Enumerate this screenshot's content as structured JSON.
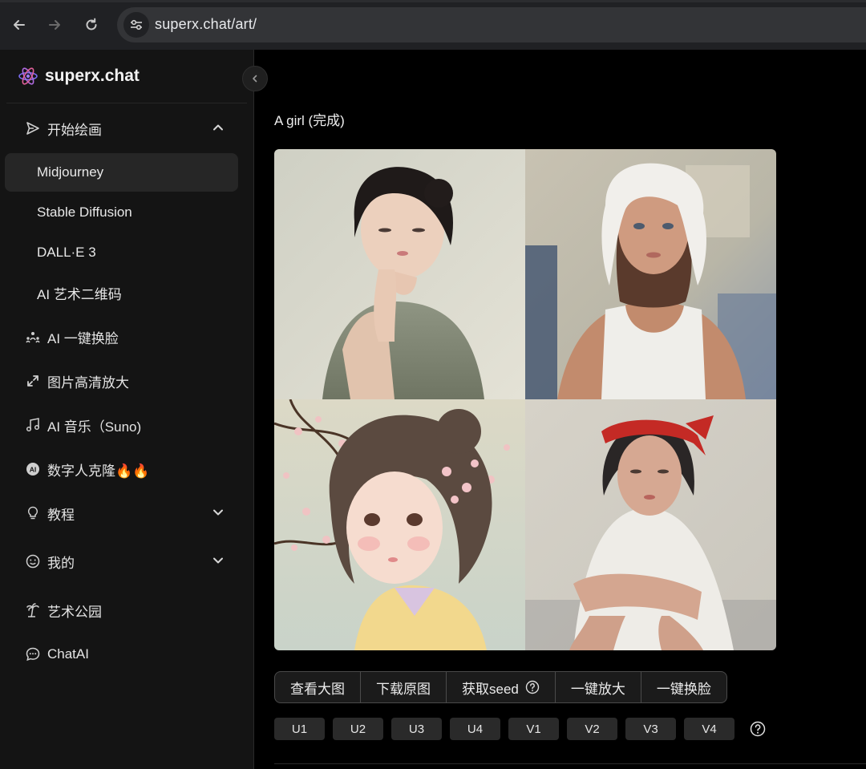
{
  "browser": {
    "url": "superx.chat/art/"
  },
  "sidebar": {
    "brand": "superx.chat",
    "groups": [
      {
        "label": "开始绘画",
        "expanded": true,
        "children": [
          {
            "label": "Midjourney",
            "active": true
          },
          {
            "label": "Stable Diffusion"
          },
          {
            "label": "DALL·E 3"
          },
          {
            "label": "AI 艺术二维码"
          }
        ]
      }
    ],
    "items": [
      {
        "label": "AI 一键换脸",
        "icon": "face-swap-icon"
      },
      {
        "label": "图片高清放大",
        "icon": "expand-arrows-icon"
      },
      {
        "label": "AI 音乐（Suno)",
        "icon": "music-note-icon"
      },
      {
        "label": "数字人克隆🔥🔥",
        "icon": "ai-avatar-icon"
      },
      {
        "label": "教程",
        "icon": "lightbulb-icon"
      },
      {
        "label": "我的",
        "icon": "smile-icon"
      },
      {
        "label": "艺术公园",
        "icon": "palm-tree-icon"
      },
      {
        "label": "ChatAI",
        "icon": "chat-bubble-icon"
      }
    ]
  },
  "main": {
    "job_title": "A girl (完成)",
    "images": [
      {
        "name": "girl-portrait-1",
        "desc_icon": "image"
      },
      {
        "name": "girl-portrait-2",
        "desc_icon": "image"
      },
      {
        "name": "girl-portrait-3",
        "desc_icon": "image"
      },
      {
        "name": "girl-portrait-4",
        "desc_icon": "image"
      }
    ],
    "actions": [
      "查看大图",
      "下载原图",
      "获取seed",
      "一键放大",
      "一键换脸"
    ],
    "upscale_variation": [
      "U1",
      "U2",
      "U3",
      "U4",
      "V1",
      "V2",
      "V3",
      "V4"
    ]
  },
  "colors": {
    "background": "#000000",
    "sidebar": "#141414",
    "active_item": "#262626",
    "chrome": "#202124"
  }
}
